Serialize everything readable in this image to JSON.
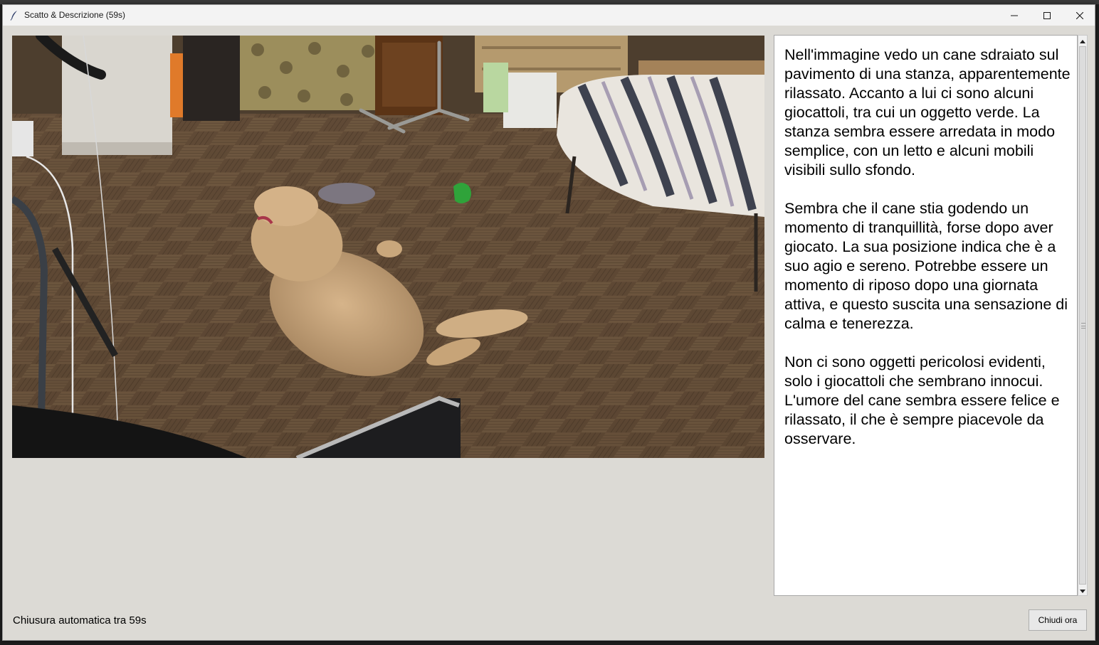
{
  "window": {
    "title": "Scatto & Descrizione (59s)"
  },
  "description": {
    "text": "Nell'immagine vedo un cane sdraiato sul pavimento di una stanza, apparentemente rilassato. Accanto a lui ci sono alcuni giocattoli, tra cui un oggetto verde. La stanza sembra essere arredata in modo semplice, con un letto e alcuni mobili visibili sullo sfondo.\n\nSembra che il cane stia godendo un momento di tranquillità, forse dopo aver giocato. La sua posizione indica che è a suo agio e sereno. Potrebbe essere un momento di riposo dopo una giornata attiva, e questo suscita una sensazione di calma e tenerezza.\n\nNon ci sono oggetti pericolosi evidenti, solo i giocattoli che sembrano innocui. L'umore del cane sembra essere felice e rilassato, il che è sempre piacevole da osservare."
  },
  "footer": {
    "status_text": "Chiusura automatica tra 59s",
    "close_button_label": "Chiudi ora"
  },
  "icons": {
    "app": "feather-icon",
    "minimize": "minimize-icon",
    "maximize": "maximize-icon",
    "close": "close-icon"
  },
  "colors": {
    "window_bg": "#dcdad5",
    "titlebar_bg": "#f3f3f3",
    "text_panel_bg": "#ffffff"
  }
}
